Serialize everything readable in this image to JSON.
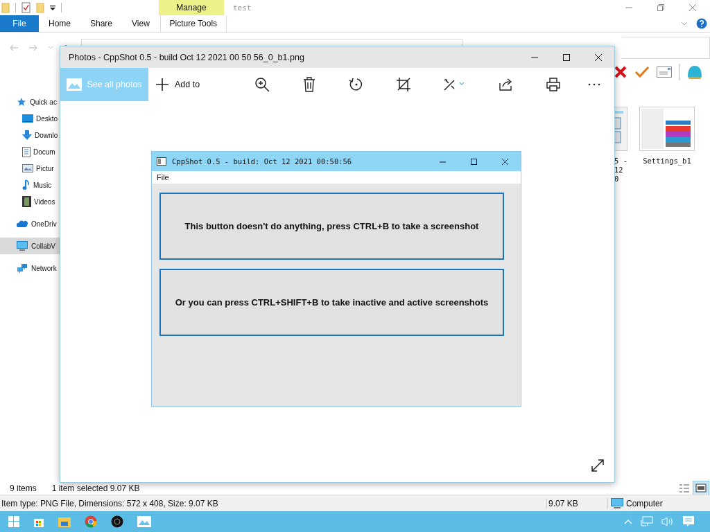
{
  "explorer": {
    "title": "test",
    "contextual_group": "Manage",
    "tabs": [
      {
        "label": "File",
        "kind": "file"
      },
      {
        "label": "Home",
        "kind": "tab"
      },
      {
        "label": "Share",
        "kind": "tab"
      },
      {
        "label": "View",
        "kind": "tab"
      },
      {
        "label": "Picture Tools",
        "kind": "contextual"
      }
    ],
    "nav": [
      {
        "label": "Quick ac",
        "kind": "star",
        "selected": false,
        "children": [
          {
            "label": "Deskto",
            "kind": "desktop",
            "selected": false
          },
          {
            "label": "Downlo",
            "kind": "download",
            "selected": false
          },
          {
            "label": "Docum",
            "kind": "document",
            "selected": false
          },
          {
            "label": "Pictur",
            "kind": "pictures",
            "selected": false
          },
          {
            "label": "Music",
            "kind": "music",
            "selected": false
          },
          {
            "label": "Videos",
            "kind": "videos",
            "selected": false
          }
        ]
      },
      {
        "label": "OneDriv",
        "kind": "cloud",
        "selected": false
      },
      {
        "label": "CollabV",
        "kind": "computer",
        "selected": true
      },
      {
        "label": "Network",
        "kind": "network",
        "selected": false
      }
    ],
    "files": [
      {
        "kind": "cppshot",
        "caption": [
          "5 -",
          "12",
          "0"
        ]
      },
      {
        "kind": "settings",
        "caption": [
          "Settings_b1"
        ]
      }
    ],
    "status": {
      "count": "9 items",
      "selection": "1 item selected  9.07 KB"
    },
    "views": [
      {
        "kind": "details",
        "selected": false
      },
      {
        "kind": "large_icons",
        "selected": true
      }
    ],
    "details": {
      "info": "Item type: PNG File, Dimensions: 572 x 408, Size: 9.07 KB",
      "size": "9.07 KB",
      "location": "Computer"
    }
  },
  "photos": {
    "title": "Photos - CppShot 0.5 - build  Oct 12 2021 00 50 56_0_b1.png",
    "toolbar": [
      {
        "kind": "see_all",
        "label": "See all photos"
      },
      {
        "kind": "add",
        "label": "Add to"
      },
      {
        "kind": "zoom"
      },
      {
        "kind": "delete"
      },
      {
        "kind": "rotate"
      },
      {
        "kind": "crop"
      },
      {
        "kind": "edit"
      },
      {
        "kind": "share"
      },
      {
        "kind": "print"
      },
      {
        "kind": "more"
      }
    ],
    "image": {
      "title": "CppShot 0.5 - build: Oct 12 2021 00:50:56",
      "menu": [
        "File"
      ],
      "buttons": [
        "This button doesn't do anything, press CTRL+B to take a screenshot",
        "Or you can press CTRL+SHIFT+B to take inactive and active screenshots"
      ]
    }
  }
}
